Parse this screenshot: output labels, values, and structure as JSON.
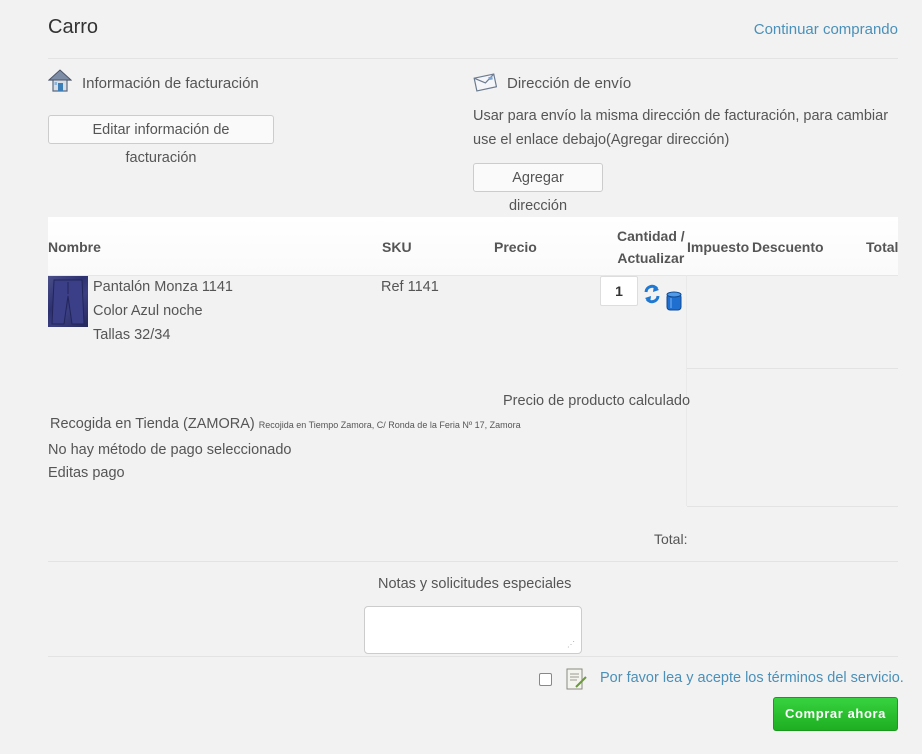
{
  "header": {
    "title": "Carro",
    "continue_label": "Continuar comprando"
  },
  "billing": {
    "heading": "Información de facturación",
    "edit_button": "Editar información de facturación",
    "icon": "house-icon"
  },
  "shipping": {
    "heading": "Dirección de envío",
    "description_line1": "Usar para envío la misma dirección de facturación, para cambiar",
    "description_line2": "use el enlace debajo(Agregar dirección)",
    "add_button": "Agregar dirección",
    "icon": "envelope-icon"
  },
  "table": {
    "headers": {
      "name": "Nombre",
      "sku": "SKU",
      "price": "Precio",
      "qty_line1": "Cantidad /",
      "qty_line2": "Actualizar",
      "tax": "Impuesto",
      "discount": "Descuento",
      "total": "Total"
    },
    "rows": [
      {
        "product_name": "Pantalón Monza 1141",
        "attr_color": "Color Azul noche",
        "attr_size": "Tallas 32/34",
        "sku": "Ref 1141",
        "quantity": "1"
      }
    ]
  },
  "summary": {
    "calculated_label": "Precio de producto calculado",
    "shipping_method": "Recogida en Tienda (ZAMORA)",
    "shipping_detail": "Recojida en Tiempo Zamora, C/ Ronda de la Feria Nº 17, Zamora",
    "payment_status": "No hay método de pago seleccionado",
    "edit_payment": "Editas pago",
    "total_label": "Total:"
  },
  "notes": {
    "label": "Notas y solicitudes especiales",
    "value": ""
  },
  "terms": {
    "label": "Por favor lea y acepte los términos del servicio."
  },
  "checkout": {
    "label": "Comprar ahora",
    "color": "#2bc231"
  },
  "colors": {
    "link": "#4a90b8",
    "background": "#f2f2f2"
  }
}
